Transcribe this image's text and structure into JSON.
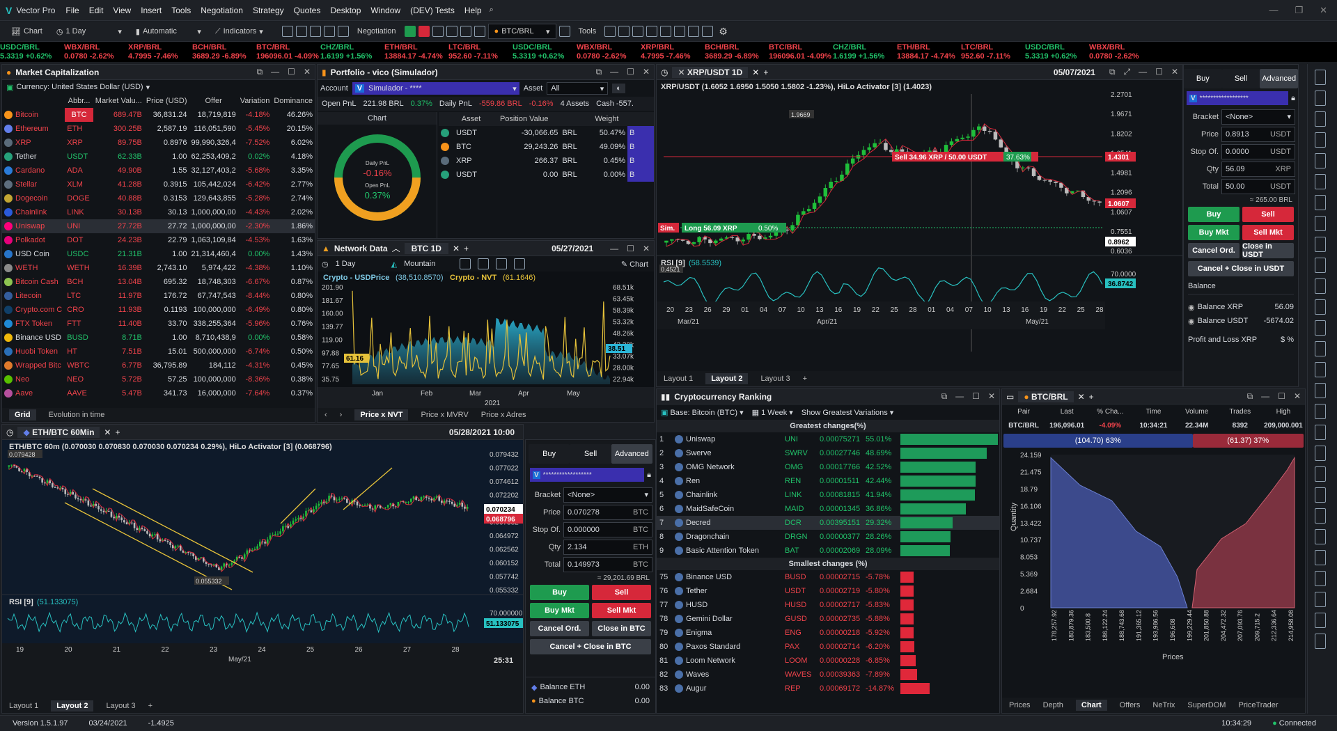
{
  "app": {
    "name": "Vector Pro",
    "menu": [
      "File",
      "Edit",
      "View",
      "Insert",
      "Tools",
      "Negotiation",
      "Strategy",
      "Quotes",
      "Desktop",
      "Window",
      "(DEV) Tests",
      "Help"
    ]
  },
  "toolbar": {
    "chart": "Chart",
    "period": "1 Day",
    "mode": "Automatic",
    "indicators": "Indicators",
    "negotiation": "Negotiation",
    "symbol": "BTC/BRL",
    "tools": "Tools"
  },
  "ticker": [
    {
      "s": "USDC/BRL",
      "v": "5.3319 +0.62%",
      "up": true
    },
    {
      "s": "WBX/BRL",
      "v": "0.0780 -2.62%",
      "up": false
    },
    {
      "s": "XRP/BRL",
      "v": "4.7995 -7.46%",
      "up": false
    },
    {
      "s": "BCH/BRL",
      "v": "3689.29 -6.89%",
      "up": false
    },
    {
      "s": "BTC/BRL",
      "v": "196096.01 -4.09%",
      "up": false
    },
    {
      "s": "CHZ/BRL",
      "v": "1.6199 +1.56%",
      "up": true
    },
    {
      "s": "ETH/BRL",
      "v": "13884.17 -4.74%",
      "up": false
    },
    {
      "s": "LTC/BRL",
      "v": "952.60 -7.11%",
      "up": false
    },
    {
      "s": "USDC/BRL",
      "v": "5.3319 +0.62%",
      "up": true
    },
    {
      "s": "WBX/BRL",
      "v": "0.0780 -2.62%",
      "up": false
    },
    {
      "s": "XRP/BRL",
      "v": "4.7995 -7.46%",
      "up": false
    },
    {
      "s": "BCH/BRL",
      "v": "3689.29 -6.89%",
      "up": false
    },
    {
      "s": "BTC/BRL",
      "v": "196096.01 -4.09%",
      "up": false
    },
    {
      "s": "CHZ/BRL",
      "v": "1.6199 +1.56%",
      "up": true
    },
    {
      "s": "ETH/BRL",
      "v": "13884.17 -4.74%",
      "up": false
    },
    {
      "s": "LTC/BRL",
      "v": "952.60 -7.11%",
      "up": false
    },
    {
      "s": "USDC/BRL",
      "v": "5.3319 +0.62%",
      "up": true
    },
    {
      "s": "WBX/BRL",
      "v": "0.0780 -2.62%",
      "up": false
    }
  ],
  "market_cap": {
    "title": "Market Capitalization",
    "currency": "Currency: United States Dollar (USD)",
    "headers": [
      "",
      "Abbr...",
      "Market Valu...",
      "Price (USD)",
      "Offer",
      "Variation",
      "Dominance"
    ],
    "rows": [
      [
        "Bitcoin",
        "BTC",
        "689.47B",
        "36,831.24",
        "18,719,819",
        "-4.18%",
        "46.26%"
      ],
      [
        "Ethereum",
        "ETH",
        "300.25B",
        "2,587.19",
        "116,051,590",
        "-5.45%",
        "20.15%"
      ],
      [
        "XRP",
        "XRP",
        "89.75B",
        "0.8976",
        "99,990,326,4",
        "-7.52%",
        "6.02%"
      ],
      [
        "Tether",
        "USDT",
        "62.33B",
        "1.00",
        "62,253,409,2",
        "0.02%",
        "4.18%"
      ],
      [
        "Cardano",
        "ADA",
        "49.90B",
        "1.55",
        "32,127,403,2",
        "-5.68%",
        "3.35%"
      ],
      [
        "Stellar",
        "XLM",
        "41.28B",
        "0.3915",
        "105,442,024",
        "-6.42%",
        "2.77%"
      ],
      [
        "Dogecoin",
        "DOGE",
        "40.88B",
        "0.3153",
        "129,643,855",
        "-5.28%",
        "2.74%"
      ],
      [
        "Chainlink",
        "LINK",
        "30.13B",
        "30.13",
        "1,000,000,00",
        "-4.43%",
        "2.02%"
      ],
      [
        "Uniswap",
        "UNI",
        "27.72B",
        "27.72",
        "1,000,000,00",
        "-2.30%",
        "1.86%"
      ],
      [
        "Polkadot",
        "DOT",
        "24.23B",
        "22.79",
        "1,063,109,84",
        "-4.53%",
        "1.63%"
      ],
      [
        "USD Coin",
        "USDC",
        "21.31B",
        "1.00",
        "21,314,460,4",
        "0.00%",
        "1.43%"
      ],
      [
        "WETH",
        "WETH",
        "16.39B",
        "2,743.10",
        "5,974,422",
        "-4.38%",
        "1.10%"
      ],
      [
        "Bitcoin Cash",
        "BCH",
        "13.04B",
        "695.32",
        "18,748,303",
        "-6.67%",
        "0.87%"
      ],
      [
        "Litecoin",
        "LTC",
        "11.97B",
        "176.72",
        "67,747,543",
        "-8.44%",
        "0.80%"
      ],
      [
        "Crypto.com C",
        "CRO",
        "11.93B",
        "0.1193",
        "100,000,000",
        "-6.49%",
        "0.80%"
      ],
      [
        "FTX Token",
        "FTT",
        "11.40B",
        "33.70",
        "338,255,364",
        "-5.96%",
        "0.76%"
      ],
      [
        "Binance USD",
        "BUSD",
        "8.71B",
        "1.00",
        "8,710,438,9",
        "0.00%",
        "0.58%"
      ],
      [
        "Huobi Token",
        "HT",
        "7.51B",
        "15.01",
        "500,000,000",
        "-6.74%",
        "0.50%"
      ],
      [
        "Wrapped Bitc",
        "WBTC",
        "6.77B",
        "36,795.89",
        "184,112",
        "-4.31%",
        "0.45%"
      ],
      [
        "Neo",
        "NEO",
        "5.72B",
        "57.25",
        "100,000,000",
        "-8.36%",
        "0.38%"
      ],
      [
        "Aave",
        "AAVE",
        "5.47B",
        "341.73",
        "16,000,000",
        "-7.64%",
        "0.37%"
      ]
    ],
    "colors": [
      "#f7931a",
      "#627eea",
      "#5a6b7a",
      "#26a17b",
      "#2a7bd8",
      "#5d6d7e",
      "#c2a633",
      "#2a5ada",
      "#ff007a",
      "#e6007a",
      "#2775ca",
      "#8a8a8a",
      "#8dc351",
      "#345d9d",
      "#103f68",
      "#1f8ad6",
      "#f0b90b",
      "#2a6fb8",
      "#e07a2c",
      "#58bf00",
      "#b6509e"
    ],
    "tabs": [
      "Grid",
      "Evolution in time"
    ]
  },
  "portfolio": {
    "title": "Portfolio - vico (Simulador)",
    "account_label": "Account",
    "account": "Simulador - ****",
    "asset_label": "Asset",
    "asset": "All",
    "open_pnl_label": "Open PnL",
    "open_pnl": "221.98 BRL",
    "open_pnl_pct": "0.37%",
    "daily_pnl_label": "Daily PnL",
    "daily_pnl": "-559.86 BRL",
    "daily_pnl_pct": "-0.16%",
    "assets": "4 Assets",
    "cash": "Cash -557.",
    "chart_label": "Chart",
    "donut_daily_label": "Daily PnL",
    "donut_daily": "-0.16%",
    "donut_open_label": "Open PnL",
    "donut_open": "0.37%",
    "headers": [
      "Asset",
      "Position Value",
      "Weight"
    ],
    "rows": [
      [
        "USDT",
        "-30,066.65",
        "BRL",
        "50.47%"
      ],
      [
        "BTC",
        "29,243.26",
        "BRL",
        "49.09%"
      ],
      [
        "XRP",
        "266.37",
        "BRL",
        "0.45%"
      ],
      [
        "USDT",
        "0.00",
        "BRL",
        "0.00%"
      ]
    ]
  },
  "network": {
    "title": "Network Data",
    "tab": "BTC 1D",
    "date": "05/27/2021",
    "period": "1 Day",
    "style": "Mountain",
    "chart": "Chart",
    "legend1": "Crypto - USDPrice",
    "legend1_v": "(38,510.8570)",
    "legend2": "Crypto - NVT",
    "legend2_v": "(61.1646)",
    "left_ticks": [
      "201.90",
      "181.67",
      "160.00",
      "139.77",
      "119.00",
      "97.88",
      "77.65",
      "35.75"
    ],
    "right_ticks": [
      "68.51k",
      "63.45k",
      "58.39k",
      "53.32k",
      "48.26k",
      "43.20k",
      "33.07k",
      "28.00k",
      "22.94k"
    ],
    "left_marker": "61.16",
    "right_marker": "38.51",
    "x_ticks": [
      "Jan",
      "Feb",
      "Mar",
      "Apr",
      "May"
    ],
    "year": "2021",
    "tabs": [
      "Price x NVT",
      "Price x MVRV",
      "Price x Adres"
    ]
  },
  "xrp": {
    "tab": "XRP/USDT 1D",
    "date": "05/07/2021",
    "ohlc": "XRP/USDT (1.6052 1.6950 1.5050 1.5802 -1.23%), HiLo Activator [3] (1.4023)",
    "sell_label": "Sell 34.96 XRP / 50.00 USDT",
    "sell_pct": "37.63%",
    "long_label": "Long 56.09 XRP",
    "long_pct": "0.50%",
    "sim": "Sim.",
    "hi_label": "1.9669",
    "lo_label": "0.4521",
    "price_tag": "1.4301",
    "red_tag": "1.0607",
    "cur_tag": "0.8962",
    "y_ticks": [
      "2.2701",
      "1.9671",
      "1.8202",
      "1.6541",
      "1.4981",
      "1.2096",
      "1.0607",
      "0.7551",
      "0.6036"
    ],
    "rsi": "RSI [9]",
    "rsi_v": "(58.5539)",
    "rsi_tick": "70.0000",
    "rsi_tag": "36.8742",
    "x_ticks": [
      "20",
      "23",
      "26",
      "29",
      "01",
      "04",
      "07",
      "10",
      "13",
      "16",
      "19",
      "22",
      "25",
      "28",
      "01",
      "04",
      "07",
      "10",
      "13",
      "16",
      "19",
      "22",
      "25",
      "28"
    ],
    "months": [
      "Mar/21",
      "Apr/21",
      "May/21"
    ],
    "layouts": [
      "Layout 1",
      "Layout 2",
      "Layout 3"
    ]
  },
  "order_xrp": {
    "tabs": [
      "Buy",
      "Sell",
      "Advanced"
    ],
    "account": "******************",
    "bracket_label": "Bracket",
    "bracket": "<None>",
    "price_label": "Price",
    "price": "0.8913",
    "price_unit": "USDT",
    "stop_label": "Stop Of.",
    "stop": "0.0000",
    "stop_unit": "USDT",
    "qty_label": "Qty",
    "qty": "56.09",
    "qty_unit": "XRP",
    "total_label": "Total",
    "total": "50.00",
    "total_unit": "USDT",
    "approx": "≈ 265.00 BRL",
    "buy": "Buy",
    "sell": "Sell",
    "buy_mkt": "Buy Mkt",
    "sell_mkt": "Sell Mkt",
    "cancel": "Cancel Ord.",
    "close": "Close in USDT",
    "cancel_close": "Cancel + Close in USDT",
    "balance": "Balance",
    "bal1_label": "Balance XRP",
    "bal1": "56.09",
    "bal2_label": "Balance USDT",
    "bal2": "-5674.02",
    "pnl": "Profit and Loss XRP"
  },
  "eth": {
    "tab": "ETH/BTC 60Min",
    "date": "05/28/2021 10:00",
    "ohlc": "ETH/BTC 60m (0.070030 0.070830 0.070030 0.070234 0.29%), HiLo Activator [3] (0.068796)",
    "hi_label": "0.079428",
    "lo_label": "0.055332",
    "tag1": "0.070234",
    "tag2": "0.068796",
    "y_ticks": [
      "0.079432",
      "0.077022",
      "0.074612",
      "0.072202",
      "0.069792",
      "0.067382",
      "0.064972",
      "0.062562",
      "0.060152",
      "0.057742",
      "0.055332"
    ],
    "rsi": "RSI [9]",
    "rsi_v": "(51.133075)",
    "rsi_tick": "70.000000",
    "rsi_tag": "51.133075",
    "x_ticks": [
      "19",
      "20",
      "21",
      "22",
      "23",
      "24",
      "25",
      "26",
      "27",
      "28"
    ],
    "month": "May/21",
    "clock": "25:31",
    "layouts": [
      "Layout 1",
      "Layout 2",
      "Layout 3"
    ]
  },
  "order_eth": {
    "tabs": [
      "Buy",
      "Sell",
      "Advanced"
    ],
    "account": "******************",
    "bracket_label": "Bracket",
    "bracket": "<None>",
    "price_label": "Price",
    "price": "0.070278",
    "price_unit": "BTC",
    "stop_label": "Stop Of.",
    "stop": "0.000000",
    "stop_unit": "BTC",
    "qty_label": "Qty",
    "qty": "2.134",
    "qty_unit": "ETH",
    "total_label": "Total",
    "total": "0.149973",
    "total_unit": "BTC",
    "approx": "≈ 29,201.69 BRL",
    "buy": "Buy",
    "sell": "Sell",
    "buy_mkt": "Buy Mkt",
    "sell_mkt": "Sell Mkt",
    "cancel": "Cancel Ord.",
    "close": "Close in BTC",
    "cancel_close": "Cancel + Close in BTC",
    "bal1_label": "Balance ETH",
    "bal1": "0.00",
    "bal2_label": "Balance BTC",
    "bal2": "0.00"
  },
  "ranking": {
    "title": "Cryptocurrency Ranking",
    "base": "Base: Bitcoin (BTC)",
    "period": "1 Week",
    "show": "Show Greatest Variations",
    "greatest_title": "Greatest changes(%)",
    "smallest_title": "Smallest changes (%)",
    "greatest": [
      [
        "1",
        "Uniswap",
        "UNI",
        "0.00075271",
        "55.01%",
        55.01
      ],
      [
        "2",
        "Swerve",
        "SWRV",
        "0.00027746",
        "48.69%",
        48.69
      ],
      [
        "3",
        "OMG Network",
        "OMG",
        "0.00017766",
        "42.52%",
        42.52
      ],
      [
        "4",
        "Ren",
        "REN",
        "0.00001511",
        "42.44%",
        42.44
      ],
      [
        "5",
        "Chainlink",
        "LINK",
        "0.00081815",
        "41.94%",
        41.94
      ],
      [
        "6",
        "MaidSafeCoin",
        "MAID",
        "0.00001345",
        "36.86%",
        36.86
      ],
      [
        "7",
        "Decred",
        "DCR",
        "0.00395151",
        "29.32%",
        29.32
      ],
      [
        "8",
        "Dragonchain",
        "DRGN",
        "0.00000377",
        "28.26%",
        28.26
      ],
      [
        "9",
        "Basic Attention Token",
        "BAT",
        "0.00002069",
        "28.09%",
        28.09
      ]
    ],
    "smallest": [
      [
        "75",
        "Binance USD",
        "BUSD",
        "0.00002715",
        "-5.78%",
        5.78
      ],
      [
        "76",
        "Tether",
        "USDT",
        "0.00002719",
        "-5.80%",
        5.8
      ],
      [
        "77",
        "HUSD",
        "HUSD",
        "0.00002717",
        "-5.83%",
        5.83
      ],
      [
        "78",
        "Gemini Dollar",
        "GUSD",
        "0.00002735",
        "-5.88%",
        5.88
      ],
      [
        "79",
        "Enigma",
        "ENG",
        "0.00000218",
        "-5.92%",
        5.92
      ],
      [
        "80",
        "Paxos Standard",
        "PAX",
        "0.00002714",
        "-6.20%",
        6.2
      ],
      [
        "81",
        "Loom Network",
        "LOOM",
        "0.00000228",
        "-6.85%",
        6.85
      ],
      [
        "82",
        "Waves",
        "WAVES",
        "0.00039363",
        "-7.89%",
        7.89
      ],
      [
        "83",
        "Augur",
        "REP",
        "0.00069172",
        "-14.87%",
        14.87
      ]
    ]
  },
  "book": {
    "tab": "BTC/BRL",
    "headers": [
      "Pair",
      "Last",
      "% Cha...",
      "Time",
      "Volume",
      "Trades",
      "High"
    ],
    "row": [
      "BTC/BRL",
      "196,096.01",
      "-4.09%",
      "10:34:21",
      "22.34M",
      "8392",
      "209,000.001"
    ],
    "bid": "(104.70) 63%",
    "ask": "(61.37) 37%",
    "bid_pct": 63,
    "y_label": "Quantity",
    "x_label": "Prices",
    "y_ticks": [
      "24.159",
      "21.475",
      "18.79",
      "16.106",
      "13.422",
      "10.737",
      "8.053",
      "5.369",
      "2.684",
      "0"
    ],
    "x_ticks": [
      "178,257.92",
      "180,879.36",
      "183,500.8",
      "186,122.24",
      "188,743.68",
      "191,365.12",
      "193,986.56",
      "196,608",
      "199,229.44",
      "201,850.88",
      "204,472.32",
      "207,093.76",
      "209,715.2",
      "212,336.64",
      "214,958.08"
    ],
    "tabs": [
      "Prices",
      "Depth",
      "Chart",
      "Offers",
      "NeTrix",
      "SuperDOM",
      "PriceTrader"
    ]
  },
  "status": {
    "version": "Version 1.5.1.97",
    "date": "03/24/2021",
    "value": "-1.4925",
    "time": "10:34:29",
    "conn": "Connected"
  }
}
